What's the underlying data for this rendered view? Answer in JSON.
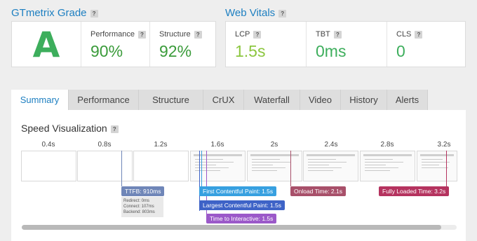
{
  "grade": {
    "title": "GTmetrix Grade",
    "help": "?",
    "letter": "A",
    "performance_label": "Performance",
    "performance_value": "90%",
    "structure_label": "Structure",
    "structure_value": "92%",
    "grade_color": "#3dae5c",
    "value_color": "#3a9b3a"
  },
  "vitals": {
    "title": "Web Vitals",
    "help": "?",
    "lcp_label": "LCP",
    "lcp_value": "1.5s",
    "lcp_color": "#8cc63f",
    "tbt_label": "TBT",
    "tbt_value": "0ms",
    "tbt_color": "#3dae5c",
    "cls_label": "CLS",
    "cls_value": "0",
    "cls_color": "#3dae5c"
  },
  "tabs": [
    "Summary",
    "Performance",
    "Structure",
    "CrUX",
    "Waterfall",
    "Video",
    "History",
    "Alerts"
  ],
  "active_tab": "Summary",
  "speed": {
    "title": "Speed Visualization",
    "help": "?",
    "ticks": [
      "0.4s",
      "0.8s",
      "1.2s",
      "1.6s",
      "2s",
      "2.4s",
      "2.8s",
      "3.2s"
    ],
    "markers": {
      "ttfb": "TTFB: 910ms",
      "ttfb_redirect": "Redirect: 0ms",
      "ttfb_connect": "Connect: 107ms",
      "ttfb_backend": "Backend: 803ms",
      "fcp": "First Contentful Paint: 1.5s",
      "lcp": "Largest Contentful Paint: 1.5s",
      "tti": "Time to Interactive: 1.5s",
      "onload": "Onload Time: 2.1s",
      "fully_loaded": "Fully Loaded Time: 3.2s"
    },
    "colors": {
      "ttfb": "#6f86b8",
      "fcp": "#37a0e0",
      "lcp": "#3e63c7",
      "tti": "#9b59c9",
      "onload": "#a8506a",
      "fully_loaded": "#b5335f"
    }
  }
}
